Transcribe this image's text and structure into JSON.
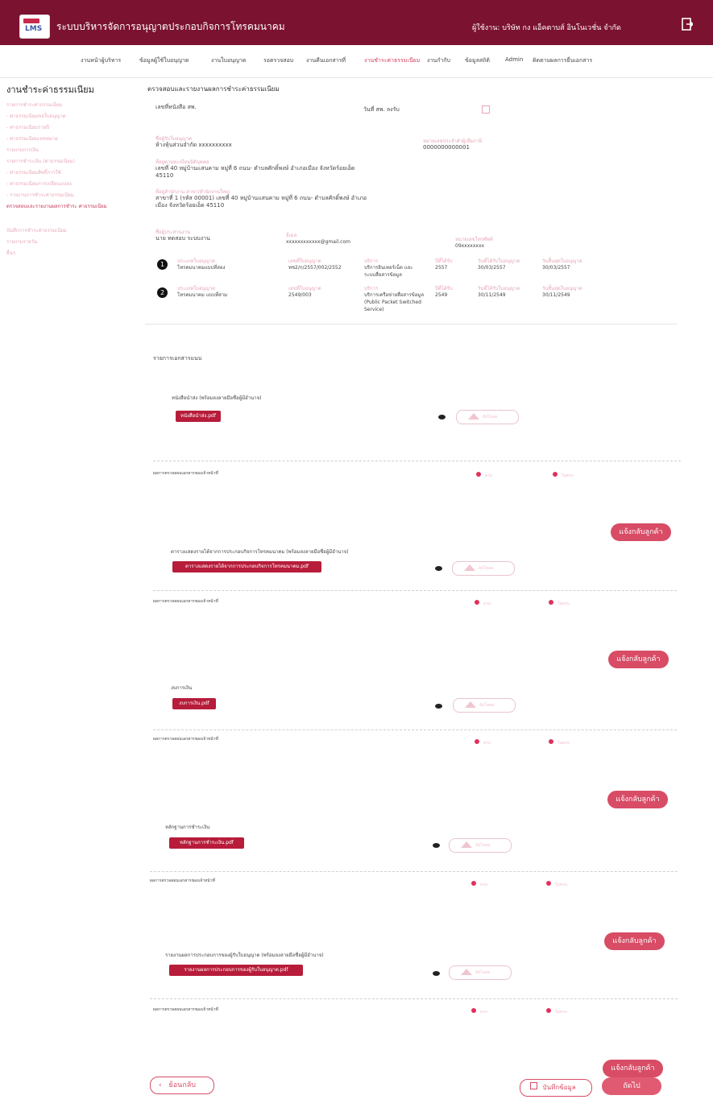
{
  "header": {
    "app_title": "ระบบบริหารจัดการอนุญาตประกอบกิจการโทรคมนาคม",
    "user_text": "ผู้ใช้งาน: บริษัท กง แอ็คตาบส์ อินโนเวชั่น จำกัด",
    "logo_text": "LMS"
  },
  "nav": {
    "items": [
      "งานหน้าผู้บริหาร",
      "ข้อมูลผู้ใช้ใบอนุญาต",
      "งานใบอนุญาต",
      "รอตรวจสอบ",
      "งานคืนเอกสารที่",
      "งานชำระค่าธรรมเนียม",
      "งานกำกับ",
      "ข้อมูลสถิติ",
      "Admin",
      "ติดตามผลการยื่นเอกสาร"
    ]
  },
  "sidebar": {
    "title": "งานชำระค่าธรรมเนียม",
    "items": [
      "รายการชำระค่าธรรมเนียม",
      "- ค่าธรรมเนียมขอใบอนุญาต",
      "- ค่าธรรมเนียมรายปี",
      "- ค่าธรรมเนียมเลขหมาย",
      "รายงานการเงิน",
      "รายการชำระเงิน (ค่าธรรมเนียม)",
      "- ค่าธรรมเนียมสิทธิ์การใช้",
      "- ค่าธรรมเนียมการเปลี่ยนแปลง",
      "- รายงานการชำระค่าธรรมเนียม",
      "ตรวจสอบและรายงานผลการชำระ ค่าธรรมเนียม",
      "บันทึกการชำระค่าธรรมเนียม",
      "รายงานรายวัน",
      "อื่นๆ"
    ]
  },
  "main": {
    "page_title": "ตรวจสอบและรายงานผลการชำระค่าธรรมเนียม",
    "doc_no": "เลขที่หนังสือ สพ.",
    "date_label": "วันที่ สพ. ลงรับ",
    "company_label": "ชื่อผู้รับใบอนุญาต",
    "company_value": "ห้างหุ้นส่วนจำกัด xxxxxxxxxx",
    "taxid_label": "หมายเลขประจำตัวผู้เสียภาษี",
    "taxid_value": "0000000000001",
    "address_label": "ที่อยู่ตามทะเบียนนิติบุคคล",
    "address_value": "เลขที่ 40 หมู่บ้านแสนคาม หมู่ที่ 6 ถนน- ตำบลศักดิ์พงษ์ อำเภอเมือง จังหวัดร้อยเอ็ด 45110",
    "office_label": "ที่อยู่สำนักงาน สาขา/สำนักงานใหญ่",
    "office_value": "สาขาที่ 1 (รหัส 00001) เลขที่ 40 หมู่บ้านแสนคาม หมู่ที่ 6 ถนน- ตำบลศักดิ์พงษ์ อำเภอเมือง จังหวัดร้อยเอ็ด 45110",
    "contact_label": "ชื่อผู้ประสานงาน",
    "contact_value": "นาย ทดสอบ ระบบงาน",
    "email_label": "อีเมล",
    "email_value": "xxxxxxxxxxxx@gmail.com",
    "phone_label": "หมายเลขโทรศัพท์",
    "phone_value": "09xxxxxxxx",
    "licenses": [
      {
        "no": "1",
        "type": "โทรคมนาคมแบบที่สอง",
        "license_no": "ทช2/ก/2557/002/2552",
        "service": "บริการอินเทอร์เน็ต และระบบสื่อสารข้อมูล",
        "year": "2557",
        "start": "30/03/2557",
        "end": "30/03/2557"
      },
      {
        "no": "2",
        "type": "โทรคมนาคม แบบที่สาม",
        "license_no": "2549/003",
        "service": "บริการเครือข่ายสื่อสารข้อมูล (Public Packet Switched Service)",
        "year": "2549",
        "start": "30/11/2549",
        "end": "30/11/2549"
      }
    ],
    "lic_headers": [
      "ประเภทใบอนุญาต",
      "เลขที่ใบอนุญาต",
      "บริการ",
      "ปีที่ได้รับ",
      "วันที่ได้รับใบอนุญาต",
      "วันสิ้นสุดใบอนุญาต"
    ],
    "docs_title": "รายการเอกสารแนบ",
    "sections": [
      {
        "title": "หนังสือนำส่ง (พร้อมลงลายมือชื่อผู้มีอำนาจ)",
        "file": "หนังสือนำส่ง.pdf"
      },
      {
        "title": "ตารางแสดงรายได้จากการประกอบกิจการโทรคมนาคม (พร้อมลงลายมือชื่อผู้มีอำนาจ)",
        "file": "ตารางแสดงรายได้จากการประกอบกิจการโทรคมนาคม.pdf"
      },
      {
        "title": "งบการเงิน",
        "file": "งบการเงิน.pdf"
      },
      {
        "title": "หลักฐานการชำระเงิน",
        "file": "หลักฐานการชำระเงิน.pdf"
      },
      {
        "title": "รายงานผลการประกอบการของผู้รับใบอนุญาต (พร้อมลงลายมือชื่อผู้มีอำนาจ)",
        "file": "รายงานผลการประกอบการของผู้รับใบอนุญาต.pdf"
      }
    ],
    "upload_text": "อัปโหลด",
    "check_label": "ผลการตรวจสอบเอกสารของเจ้าหน้าที่",
    "radio_yes": "ครบ",
    "radio_no": "ไม่ครบ",
    "return_btn": "แจ้งกลับลูกค้า",
    "back_btn": "ย้อนกลับ",
    "save_btn": "บันทึกข้อมูล",
    "next_btn": "ถัดไป"
  }
}
